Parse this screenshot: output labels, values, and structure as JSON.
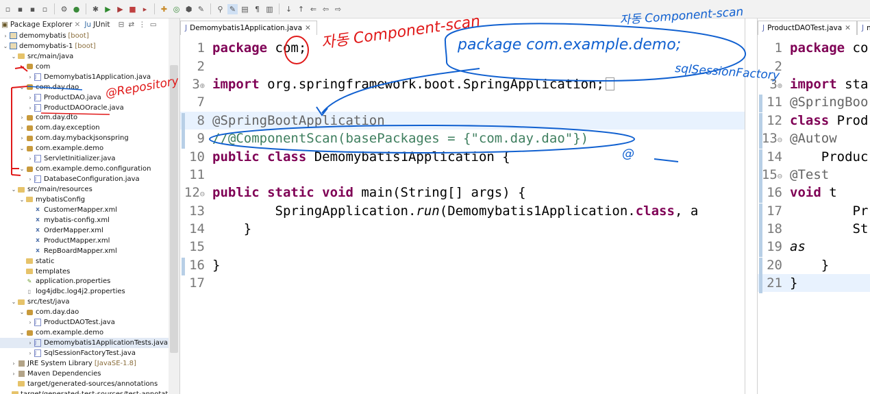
{
  "package_explorer": {
    "tabs": [
      {
        "label": "Package Explorer"
      },
      {
        "label": "JUnit"
      }
    ],
    "tree": [
      {
        "arrow": "›",
        "icon": "proj",
        "label": "demomybatis",
        "suffix": "[boot]"
      },
      {
        "arrow": "⌄",
        "icon": "proj",
        "label": "demomybatis-1",
        "suffix": "[boot]"
      },
      {
        "arrow": "⌄",
        "icon": "folder",
        "label": "src/main/java",
        "suffix": ""
      },
      {
        "arrow": "⌄",
        "icon": "pkg",
        "label": "com",
        "suffix": ""
      },
      {
        "arrow": "›",
        "icon": "java",
        "label": "Demomybatis1Application.java",
        "suffix": ""
      },
      {
        "arrow": "⌄",
        "icon": "pkg",
        "label": "com.day.dao",
        "suffix": ""
      },
      {
        "arrow": "›",
        "icon": "java",
        "label": "ProductDAO.java",
        "suffix": ""
      },
      {
        "arrow": "›",
        "icon": "java",
        "label": "ProductDAOOracle.java",
        "suffix": ""
      },
      {
        "arrow": "›",
        "icon": "pkg",
        "label": "com.day.dto",
        "suffix": ""
      },
      {
        "arrow": "›",
        "icon": "pkg",
        "label": "com.day.exception",
        "suffix": ""
      },
      {
        "arrow": "›",
        "icon": "pkg",
        "label": "com.day.mybackjsonspring",
        "suffix": ""
      },
      {
        "arrow": "⌄",
        "icon": "pkg",
        "label": "com.example.demo",
        "suffix": ""
      },
      {
        "arrow": "›",
        "icon": "java",
        "label": "ServletInitializer.java",
        "suffix": ""
      },
      {
        "arrow": "⌄",
        "icon": "pkg",
        "label": "com.example.demo.configuration",
        "suffix": ""
      },
      {
        "arrow": "›",
        "icon": "java",
        "label": "DatabaseConfiguration.java",
        "suffix": ""
      },
      {
        "arrow": "⌄",
        "icon": "folder",
        "label": "src/main/resources",
        "suffix": ""
      },
      {
        "arrow": "⌄",
        "icon": "folder",
        "label": "mybatisConfig",
        "suffix": ""
      },
      {
        "arrow": "",
        "icon": "xml",
        "label": "CustomerMapper.xml",
        "suffix": ""
      },
      {
        "arrow": "",
        "icon": "xml",
        "label": "mybatis-config.xml",
        "suffix": ""
      },
      {
        "arrow": "",
        "icon": "xml",
        "label": "OrderMapper.xml",
        "suffix": ""
      },
      {
        "arrow": "",
        "icon": "xml",
        "label": "ProductMapper.xml",
        "suffix": ""
      },
      {
        "arrow": "",
        "icon": "xml",
        "label": "RepBoardMapper.xml",
        "suffix": ""
      },
      {
        "arrow": "",
        "icon": "folder",
        "label": "static",
        "suffix": ""
      },
      {
        "arrow": "",
        "icon": "folder",
        "label": "templates",
        "suffix": ""
      },
      {
        "arrow": "",
        "icon": "prop",
        "label": "application.properties",
        "suffix": ""
      },
      {
        "arrow": "",
        "icon": "file",
        "label": "log4jdbc.log4j2.properties",
        "suffix": ""
      },
      {
        "arrow": "⌄",
        "icon": "folder",
        "label": "src/test/java",
        "suffix": ""
      },
      {
        "arrow": "⌄",
        "icon": "pkg",
        "label": "com.day.dao",
        "suffix": ""
      },
      {
        "arrow": "›",
        "icon": "java",
        "label": "ProductDAOTest.java",
        "suffix": ""
      },
      {
        "arrow": "⌄",
        "icon": "pkg",
        "label": "com.example.demo",
        "suffix": ""
      },
      {
        "arrow": "›",
        "icon": "java",
        "label": "Demomybatis1ApplicationTests.java",
        "suffix": "",
        "selected": true
      },
      {
        "arrow": "›",
        "icon": "java",
        "label": "SqlSessionFactoryTest.java",
        "suffix": ""
      },
      {
        "arrow": "›",
        "icon": "lib",
        "label": "JRE System Library",
        "suffix": "[JavaSE-1.8]"
      },
      {
        "arrow": "›",
        "icon": "lib",
        "label": "Maven Dependencies",
        "suffix": ""
      },
      {
        "arrow": "",
        "icon": "folder",
        "label": "target/generated-sources/annotations",
        "suffix": ""
      },
      {
        "arrow": "",
        "icon": "folder",
        "label": "target/generated-test-sources/test-annotations",
        "suffix": ""
      }
    ]
  },
  "editor_main": {
    "tab_label": "Demomybatis1Application.java",
    "line_numbers": [
      "1",
      "2",
      "3",
      "7",
      "8",
      "9",
      "10",
      "11",
      "12",
      "13",
      "14",
      "15",
      "16",
      "17"
    ]
  },
  "editor_right": {
    "tab_label": "ProductDAOTest.java",
    "tab2_label": "m",
    "line_numbers": [
      "1",
      "2",
      "3",
      "11",
      "12",
      "13",
      "14",
      "15",
      "16",
      "17",
      "18",
      "19",
      "20",
      "21"
    ]
  },
  "annotations": {
    "auto_scan": "자동 Component-scan",
    "auto_scan_2": "자동 Component-scan",
    "repository": "@Repository",
    "package_note": "package com.example.demo;",
    "sqlsession_note": "sqlSessionFactory",
    "at_note": "@"
  }
}
